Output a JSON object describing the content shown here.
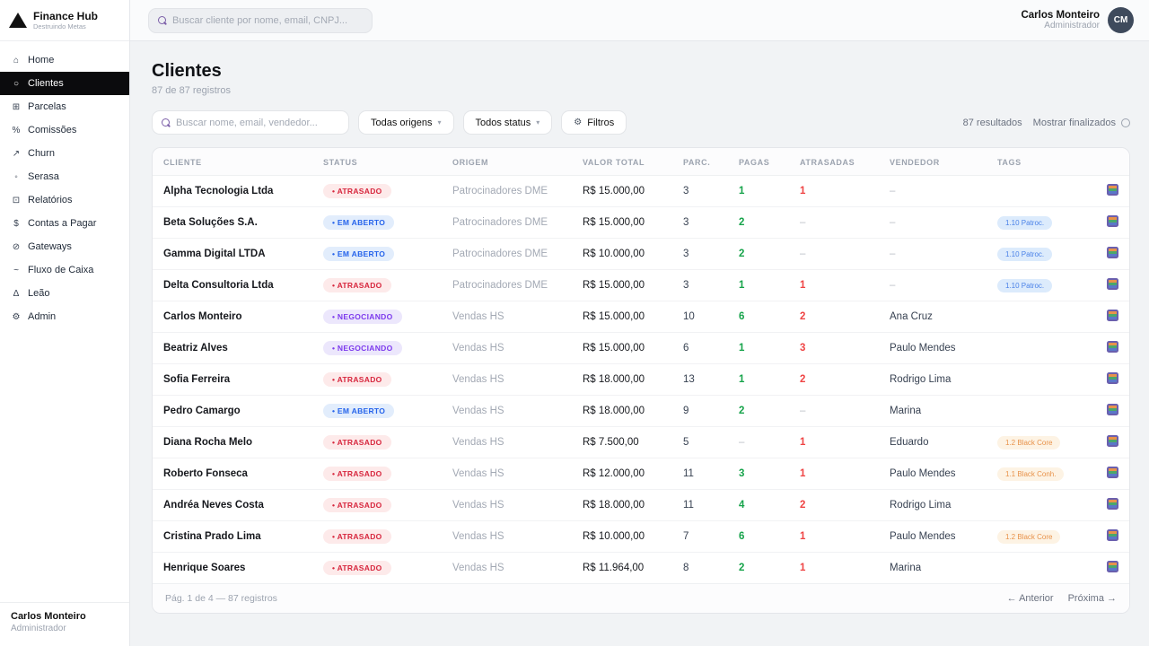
{
  "brand": {
    "name": "Finance Hub",
    "tagline": "Destruindo Metas"
  },
  "topbar": {
    "search_placeholder": "Buscar cliente por nome, email, CNPJ...",
    "user_name": "Carlos Monteiro",
    "user_role": "Administrador",
    "avatar_initials": "CM"
  },
  "sidebar": {
    "items": [
      {
        "name": "home",
        "icon": "⌂",
        "label": "Home",
        "active": false
      },
      {
        "name": "clientes",
        "icon": "○",
        "label": "Clientes",
        "active": true
      },
      {
        "name": "parcelas",
        "icon": "⊞",
        "label": "Parcelas",
        "active": false
      },
      {
        "name": "comissoes",
        "icon": "%",
        "label": "Comissões",
        "active": false
      },
      {
        "name": "churn",
        "icon": "↗",
        "label": "Churn",
        "active": false
      },
      {
        "name": "serasa",
        "icon": "◦",
        "label": "Serasa",
        "active": false
      },
      {
        "name": "relatorios",
        "icon": "⊡",
        "label": "Relatórios",
        "active": false
      },
      {
        "name": "contas-a-pagar",
        "icon": "$",
        "label": "Contas a Pagar",
        "active": false
      },
      {
        "name": "gateways",
        "icon": "⊘",
        "label": "Gateways",
        "active": false
      },
      {
        "name": "fluxo-de-caixa",
        "icon": "~",
        "label": "Fluxo de Caixa",
        "active": false
      },
      {
        "name": "leao",
        "icon": "Δ",
        "label": "Leão",
        "active": false
      },
      {
        "name": "admin",
        "icon": "⚙",
        "label": "Admin",
        "active": false
      }
    ],
    "footer": {
      "name": "Carlos Monteiro",
      "role": "Administrador"
    }
  },
  "page": {
    "title": "Clientes",
    "subtitle": "87 de 87 registros"
  },
  "filters": {
    "search_placeholder": "Buscar nome, email, vendedor...",
    "origin_label": "Todas origens",
    "status_label": "Todos status",
    "filters_label": "Filtros",
    "results_label": "87 resultados",
    "toggle_label": "Mostrar finalizados"
  },
  "table": {
    "columns": [
      "CLIENTE",
      "STATUS",
      "ORIGEM",
      "VALOR TOTAL",
      "PARC.",
      "PAGAS",
      "ATRASADAS",
      "VENDEDOR",
      "TAGS",
      ""
    ],
    "rows": [
      {
        "cliente": "Alpha Tecnologia Ltda",
        "status": "ATRASADO",
        "status_type": "atrasado",
        "origem": "Patrocinadores DME",
        "valor": "R$ 15.000,00",
        "parc": "3",
        "pagas": "1",
        "atrasadas": "1",
        "vendedor": "–",
        "tag": "",
        "tag_type": ""
      },
      {
        "cliente": "Beta Soluções S.A.",
        "status": "EM ABERTO",
        "status_type": "aberto",
        "origem": "Patrocinadores DME",
        "valor": "R$ 15.000,00",
        "parc": "3",
        "pagas": "2",
        "atrasadas": "–",
        "vendedor": "–",
        "tag": "1.10 Patroc.",
        "tag_type": "blue"
      },
      {
        "cliente": "Gamma Digital LTDA",
        "status": "EM ABERTO",
        "status_type": "aberto",
        "origem": "Patrocinadores DME",
        "valor": "R$ 10.000,00",
        "parc": "3",
        "pagas": "2",
        "atrasadas": "–",
        "vendedor": "–",
        "tag": "1.10 Patroc.",
        "tag_type": "blue"
      },
      {
        "cliente": "Delta Consultoria Ltda",
        "status": "ATRASADO",
        "status_type": "atrasado",
        "origem": "Patrocinadores DME",
        "valor": "R$ 15.000,00",
        "parc": "3",
        "pagas": "1",
        "atrasadas": "1",
        "vendedor": "–",
        "tag": "1.10 Patroc.",
        "tag_type": "blue"
      },
      {
        "cliente": "Carlos Monteiro",
        "status": "NEGOCIANDO",
        "status_type": "negociando",
        "origem": "Vendas HS",
        "valor": "R$ 15.000,00",
        "parc": "10",
        "pagas": "6",
        "atrasadas": "2",
        "vendedor": "Ana Cruz",
        "tag": "",
        "tag_type": ""
      },
      {
        "cliente": "Beatriz Alves",
        "status": "NEGOCIANDO",
        "status_type": "negociando",
        "origem": "Vendas HS",
        "valor": "R$ 15.000,00",
        "parc": "6",
        "pagas": "1",
        "atrasadas": "3",
        "vendedor": "Paulo Mendes",
        "tag": "",
        "tag_type": ""
      },
      {
        "cliente": "Sofia Ferreira",
        "status": "ATRASADO",
        "status_type": "atrasado",
        "origem": "Vendas HS",
        "valor": "R$ 18.000,00",
        "parc": "13",
        "pagas": "1",
        "atrasadas": "2",
        "vendedor": "Rodrigo Lima",
        "tag": "",
        "tag_type": ""
      },
      {
        "cliente": "Pedro Camargo",
        "status": "EM ABERTO",
        "status_type": "aberto",
        "origem": "Vendas HS",
        "valor": "R$ 18.000,00",
        "parc": "9",
        "pagas": "2",
        "atrasadas": "–",
        "vendedor": "Marina",
        "tag": "",
        "tag_type": ""
      },
      {
        "cliente": "Diana Rocha Melo",
        "status": "ATRASADO",
        "status_type": "atrasado",
        "origem": "Vendas HS",
        "valor": "R$ 7.500,00",
        "parc": "5",
        "pagas": "–",
        "atrasadas": "1",
        "vendedor": "Eduardo",
        "tag": "1.2 Black Core",
        "tag_type": "orange"
      },
      {
        "cliente": "Roberto Fonseca",
        "status": "ATRASADO",
        "status_type": "atrasado",
        "origem": "Vendas HS",
        "valor": "R$ 12.000,00",
        "parc": "11",
        "pagas": "3",
        "atrasadas": "1",
        "vendedor": "Paulo Mendes",
        "tag": "1.1 Black Conh.",
        "tag_type": "orange"
      },
      {
        "cliente": "Andréa Neves Costa",
        "status": "ATRASADO",
        "status_type": "atrasado",
        "origem": "Vendas HS",
        "valor": "R$ 18.000,00",
        "parc": "11",
        "pagas": "4",
        "atrasadas": "2",
        "vendedor": "Rodrigo Lima",
        "tag": "",
        "tag_type": ""
      },
      {
        "cliente": "Cristina Prado Lima",
        "status": "ATRASADO",
        "status_type": "atrasado",
        "origem": "Vendas HS",
        "valor": "R$ 10.000,00",
        "parc": "7",
        "pagas": "6",
        "atrasadas": "1",
        "vendedor": "Paulo Mendes",
        "tag": "1.2 Black Core",
        "tag_type": "orange"
      },
      {
        "cliente": "Henrique Soares",
        "status": "ATRASADO",
        "status_type": "atrasado",
        "origem": "Vendas HS",
        "valor": "R$ 11.964,00",
        "parc": "8",
        "pagas": "2",
        "atrasadas": "1",
        "vendedor": "Marina",
        "tag": "",
        "tag_type": ""
      }
    ],
    "footer": {
      "summary": "Pág. 1 de 4 — 87 registros",
      "prev": "← Anterior",
      "next": "Próxima →"
    }
  },
  "colors": {
    "accent_dark": "#0b0b0d",
    "status_atrasado_text": "#d7263d",
    "status_aberto_text": "#2563eb",
    "status_negociando_text": "#7c3aed",
    "pagas_green": "#16a34a",
    "atrasadas_red": "#ef4444",
    "avatar_bg": "#3e4a5c"
  }
}
